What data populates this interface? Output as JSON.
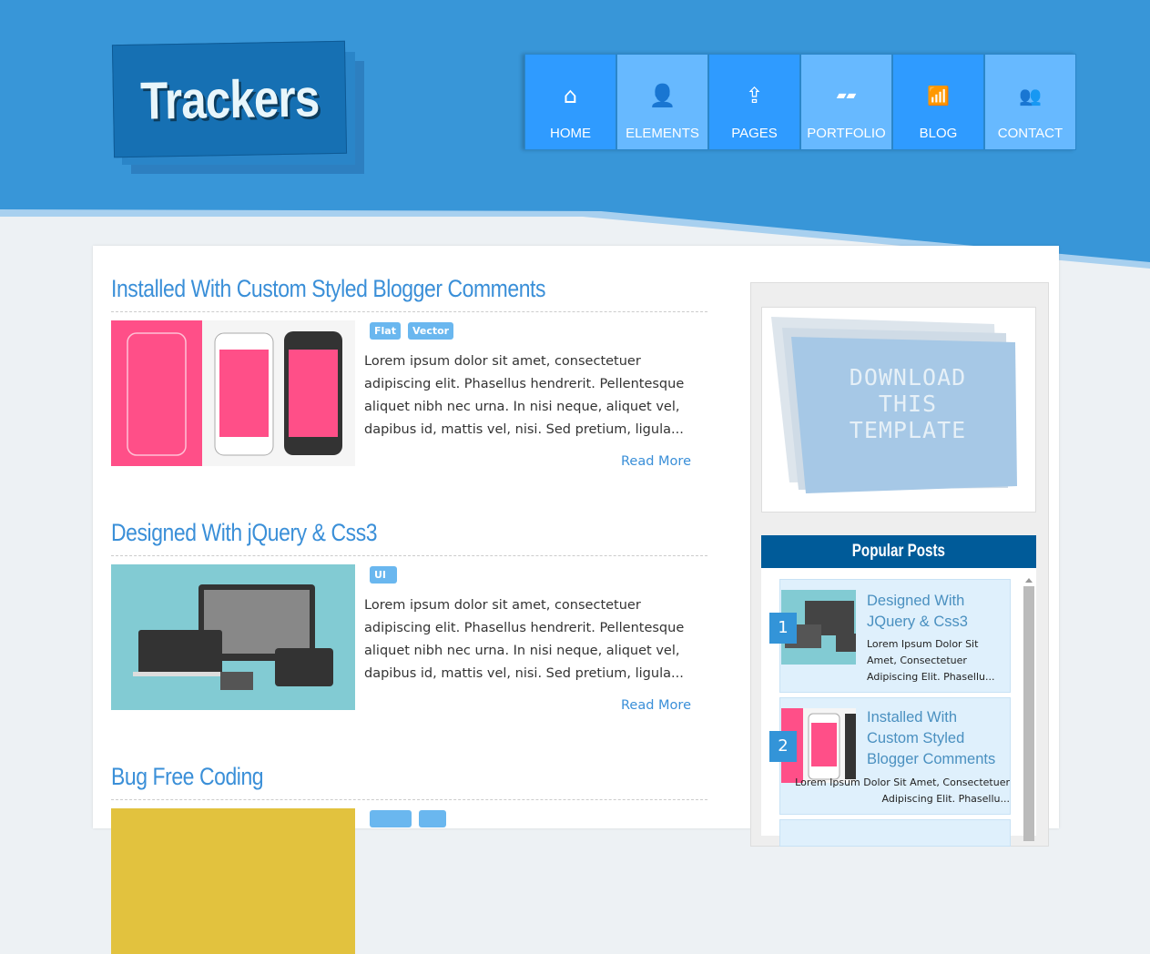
{
  "logo": {
    "text": "Trackers"
  },
  "nav": [
    {
      "label": "HOME",
      "icon": "home-icon",
      "glyph": "⌂"
    },
    {
      "label": "ELEMENTS",
      "icon": "user-add-icon",
      "glyph": "👤"
    },
    {
      "label": "PAGES",
      "icon": "window-upload-icon",
      "glyph": "⇪"
    },
    {
      "label": "PORTFOLIO",
      "icon": "grid-icon",
      "glyph": "▰▰"
    },
    {
      "label": "BLOG",
      "icon": "wifi-icon",
      "glyph": "📶"
    },
    {
      "label": "CONTACT",
      "icon": "users-icon",
      "glyph": "👥"
    }
  ],
  "posts": [
    {
      "title": "Installed With Custom Styled Blogger Comments",
      "tags": [
        "Flat",
        "Vector"
      ],
      "excerpt": "Lorem ipsum dolor sit amet, consectetuer adipiscing elit. Phasellus hendrerit. Pellentesque aliquet nibh nec urna. In nisi neque, aliquet vel, dapibus id, mattis vel, nisi. Sed pretium, ligula...",
      "read_more": "Read More"
    },
    {
      "title": "Designed With jQuery & Css3",
      "tags": [
        "UI"
      ],
      "excerpt": "Lorem ipsum dolor sit amet, consectetuer adipiscing elit. Phasellus hendrerit. Pellentesque aliquet nibh nec urna. In nisi neque, aliquet vel, dapibus id, mattis vel, nisi. Sed pretium, ligula...",
      "read_more": "Read More"
    },
    {
      "title": "Bug Free Coding"
    }
  ],
  "sidebar": {
    "download": "DOWNLOAD THIS TEMPLATE",
    "popular_title": "Popular Posts",
    "popular": [
      {
        "num": "1",
        "title": "Designed With JQuery & Css3",
        "excerpt": "Lorem Ipsum Dolor Sit Amet, Consectetuer Adipiscing Elit. Phasellu..."
      },
      {
        "num": "2",
        "title": "Installed With Custom Styled Blogger Comments",
        "excerpt": "Lorem Ipsum Dolor Sit Amet, Consectetuer Adipiscing Elit. Phasellu..."
      }
    ]
  },
  "colors": {
    "header": "#3896d8",
    "accent": "#3a8fd8",
    "nav_dark": "#2f9bff",
    "nav_light": "#67b9ff",
    "popular_header": "#005b99"
  }
}
